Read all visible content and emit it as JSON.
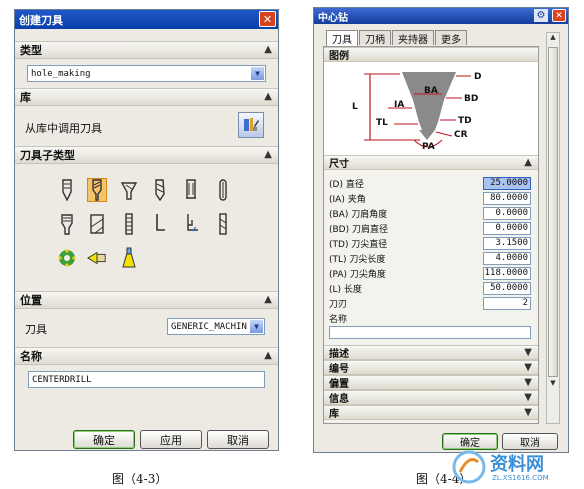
{
  "left_dialog": {
    "title": "创建刀具",
    "sections": {
      "type": {
        "header": "类型",
        "selected": "hole_making"
      },
      "library": {
        "header": "库",
        "label": "从库中调用刀具"
      },
      "subtype": {
        "header": "刀具子类型"
      },
      "location": {
        "header": "位置",
        "label": "刀具",
        "selected": "GENERIC_MACHIN"
      },
      "name": {
        "header": "名称",
        "value": "CENTERDRILL"
      }
    },
    "buttons": {
      "ok": "确定",
      "apply": "应用",
      "cancel": "取消"
    }
  },
  "right_dialog": {
    "title": "中心钻",
    "tabs": [
      "刀具",
      "刀柄",
      "夹持器",
      "更多"
    ],
    "illustration": {
      "header": "图例",
      "labels": [
        "BA",
        "D",
        "L",
        "BD",
        "IA",
        "TL",
        "TD",
        "CR",
        "PA"
      ]
    },
    "dimensions": {
      "header": "尺寸",
      "fields": [
        {
          "label": "(D) 直径",
          "value": "25.0000"
        },
        {
          "label": "(IA) 夹角",
          "value": "80.0000"
        },
        {
          "label": "(BA) 刀肩角度",
          "value": "0.0000"
        },
        {
          "label": "(BD) 刀肩直径",
          "value": "0.0000"
        },
        {
          "label": "(TD) 刀尖直径",
          "value": "3.1500"
        },
        {
          "label": "(TL) 刀尖长度",
          "value": "4.0000"
        },
        {
          "label": "(PA) 刀尖角度",
          "value": "118.0000"
        },
        {
          "label": "(L) 长度",
          "value": "50.0000"
        },
        {
          "label": "刀刃",
          "value": "2"
        }
      ],
      "name_label": "名称",
      "name_value": ""
    },
    "collapsed_sections": [
      "描述",
      "编号",
      "偏置",
      "信息",
      "库"
    ],
    "buttons": {
      "ok": "确定",
      "cancel": "取消"
    }
  },
  "captions": {
    "left": "图（4-3）",
    "right": "图（4-4）"
  },
  "watermark": {
    "brand": "资料网",
    "url": "ZL.XS1616.COM"
  },
  "colors": {
    "title_bar": "#0a3fa8",
    "selected_tool": "#f5c36a",
    "active_field": "#a9c3f1",
    "ok_button_border": "#2a6e1a"
  }
}
